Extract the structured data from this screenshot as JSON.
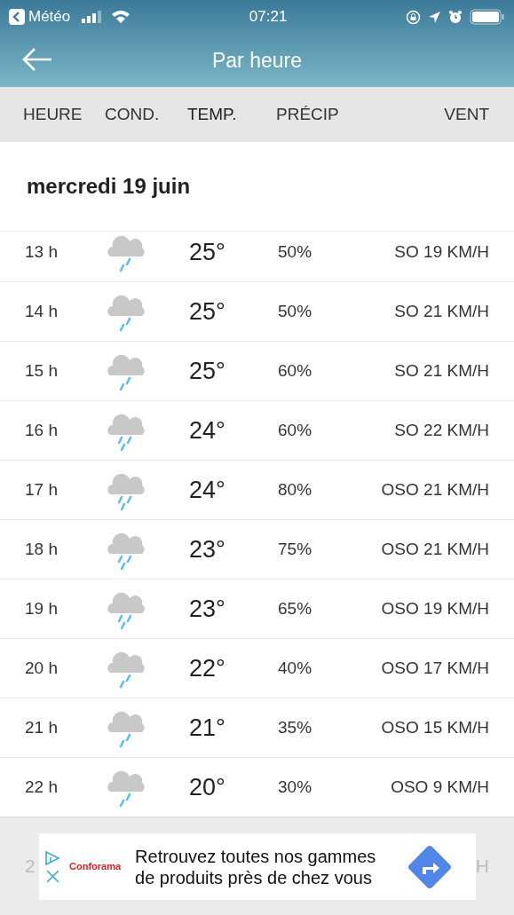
{
  "status_bar": {
    "back_app": "Météo",
    "time": "07:21"
  },
  "header": {
    "title": "Par heure"
  },
  "columns": [
    "HEURE",
    "COND.",
    "TEMP.",
    "PRÉCIP",
    "VENT"
  ],
  "day": "mercredi 19 juin",
  "rows": [
    {
      "hour": "13 h",
      "kind": "light",
      "temp": "25°",
      "precip": "50%",
      "wind": "SO 19 KM/H"
    },
    {
      "hour": "14 h",
      "kind": "light",
      "temp": "25°",
      "precip": "50%",
      "wind": "SO 21 KM/H"
    },
    {
      "hour": "15 h",
      "kind": "light",
      "temp": "25°",
      "precip": "60%",
      "wind": "SO 21 KM/H"
    },
    {
      "hour": "16 h",
      "kind": "moderate",
      "temp": "24°",
      "precip": "60%",
      "wind": "SO 22 KM/H"
    },
    {
      "hour": "17 h",
      "kind": "moderate",
      "temp": "24°",
      "precip": "80%",
      "wind": "OSO 21 KM/H"
    },
    {
      "hour": "18 h",
      "kind": "moderate",
      "temp": "23°",
      "precip": "75%",
      "wind": "OSO 21 KM/H"
    },
    {
      "hour": "19 h",
      "kind": "moderate",
      "temp": "23°",
      "precip": "65%",
      "wind": "OSO 19 KM/H"
    },
    {
      "hour": "20 h",
      "kind": "light",
      "temp": "22°",
      "precip": "40%",
      "wind": "OSO 17 KM/H"
    },
    {
      "hour": "21 h",
      "kind": "light",
      "temp": "21°",
      "precip": "35%",
      "wind": "OSO 15 KM/H"
    },
    {
      "hour": "22 h",
      "kind": "light",
      "temp": "20°",
      "precip": "30%",
      "wind": "OSO 9 KM/H"
    }
  ],
  "hidden_row": {
    "hour": "2",
    "wind": "H"
  },
  "ad": {
    "brand": "Conforama",
    "text": "Retrouvez toutes nos gammes de produits près de chez vous"
  }
}
